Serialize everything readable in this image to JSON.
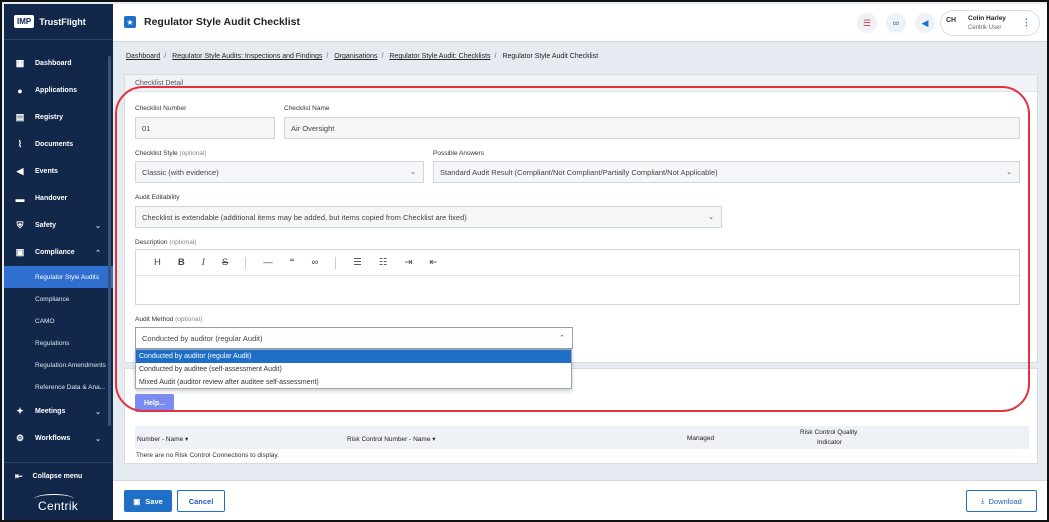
{
  "sidebar": {
    "logo_badge": "IMP",
    "brand": "TrustFlight",
    "items": [
      {
        "label": "Dashboard",
        "icon": "dashboard-icon"
      },
      {
        "label": "Applications",
        "icon": "applications-icon"
      },
      {
        "label": "Registry",
        "icon": "registry-icon"
      },
      {
        "label": "Documents",
        "icon": "documents-icon"
      },
      {
        "label": "Events",
        "icon": "events-icon"
      },
      {
        "label": "Handover",
        "icon": "handover-icon"
      },
      {
        "label": "Safety",
        "icon": "safety-icon"
      },
      {
        "label": "Compliance",
        "icon": "compliance-icon"
      }
    ],
    "compliance_subitems": [
      "Regulator Style Audits",
      "Compliance",
      "CAMO",
      "Regulations",
      "Regulation Amendments",
      "Reference Data & Ana..."
    ],
    "active_subitem": "Regulator Style Audits",
    "after_items": [
      {
        "label": "Meetings",
        "icon": "meetings-icon"
      },
      {
        "label": "Workflows",
        "icon": "workflows-icon"
      }
    ],
    "collapse_label": "Collapse menu",
    "footer_brand": "Centrik"
  },
  "topbar": {
    "title": "Regulator Style Audit Checklist",
    "user_initials": "CH",
    "user_name": "Colin Harley",
    "user_role": "Centrik User"
  },
  "breadcrumb": [
    "Dashboard",
    "Regulator Style Audits: Inspections and Findings",
    "Organisations",
    "Regulator Style Audit: Checklists",
    "Regulator Style Audit Checklist"
  ],
  "form": {
    "panel_title": "Checklist Detail",
    "checklist_number_label": "Checklist Number",
    "checklist_number_value": "01",
    "checklist_name_label": "Checklist Name",
    "checklist_name_value": "Air Oversight",
    "checklist_style_label": "Checklist Style",
    "optional_tag": "(optional)",
    "checklist_style_value": "Classic (with evidence)",
    "possible_answers_label": "Possible Answers",
    "possible_answers_value": "Standard Audit Result (Compliant/Not Compliant/Partially Compliant/Not Applicable)",
    "audit_editability_label": "Audit Editability",
    "audit_editability_value": "Checklist is extendable (additional items may be added, but items copied from Checklist are fixed)",
    "description_label": "Description",
    "audit_method_label": "Audit Method",
    "audit_method_value": "Conducted by auditor (regular Audit)",
    "audit_method_options": [
      "Conducted by auditor (regular Audit)",
      "Conducted by auditee (self-assessment Audit)",
      "Mixed Audit (auditor review after auditee self-assessment)"
    ]
  },
  "risk_control": {
    "help_label": "Help...",
    "columns": [
      "Number - Name ▾",
      "Risk Control Number - Name ▾",
      "Managed",
      "Risk Control Quality",
      "Indicator"
    ],
    "empty_text": "There are no Risk Control Connections to display."
  },
  "footer": {
    "save_label": "Save",
    "cancel_label": "Cancel",
    "download_label": "Download"
  },
  "colors": {
    "sidebar_bg": "#11284a",
    "accent": "#1f6fc7",
    "highlight": "#e0333f"
  }
}
